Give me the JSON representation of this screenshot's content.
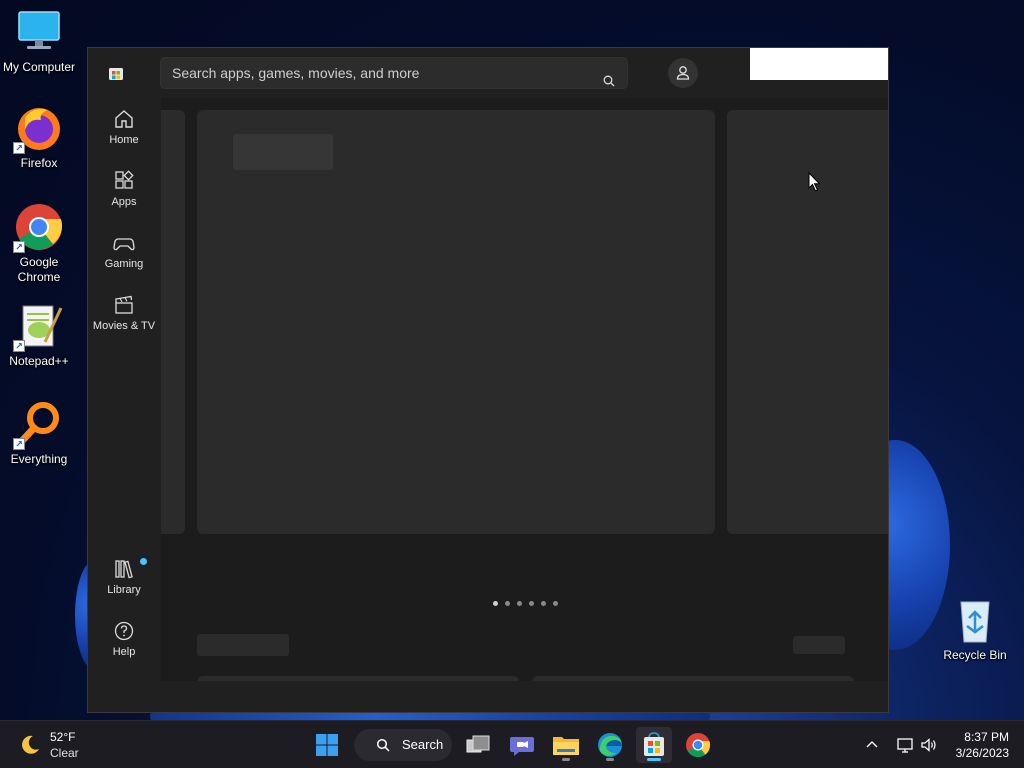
{
  "desktop": {
    "icons": [
      {
        "label": "My Computer",
        "icon": "monitor-icon"
      },
      {
        "label": "Firefox",
        "icon": "firefox-icon"
      },
      {
        "label": "Google Chrome",
        "icon": "chrome-icon"
      },
      {
        "label": "Notepad++",
        "icon": "notepadpp-icon"
      },
      {
        "label": "Everything",
        "icon": "everything-icon"
      },
      {
        "label": "Recycle Bin",
        "icon": "recycle-bin-icon"
      }
    ]
  },
  "store": {
    "search_placeholder": "Search apps, games, movies, and more",
    "nav": [
      {
        "label": "Home",
        "icon": "home-icon"
      },
      {
        "label": "Apps",
        "icon": "apps-icon"
      },
      {
        "label": "Gaming",
        "icon": "gamepad-icon"
      },
      {
        "label": "Movies & TV",
        "icon": "clapperboard-icon"
      },
      {
        "label": "Library",
        "icon": "library-icon",
        "badge": true
      },
      {
        "label": "Help",
        "icon": "help-icon"
      }
    ],
    "carousel": {
      "count": 6,
      "active": 0
    }
  },
  "taskbar": {
    "weather": {
      "temp": "52°F",
      "condition": "Clear",
      "icon": "moon-icon"
    },
    "search_label": "Search",
    "apps": [
      "start-icon",
      "task-view-icon",
      "teams-chat-icon",
      "file-explorer-icon",
      "edge-icon",
      "store-icon",
      "chrome-icon"
    ],
    "time": "8:37 PM",
    "date": "3/26/2023"
  },
  "colors": {
    "accent": "#4cc2ff",
    "window_bg": "#202020",
    "card_bg": "#2b2b2b",
    "taskbar_bg": "#1c1c22"
  }
}
